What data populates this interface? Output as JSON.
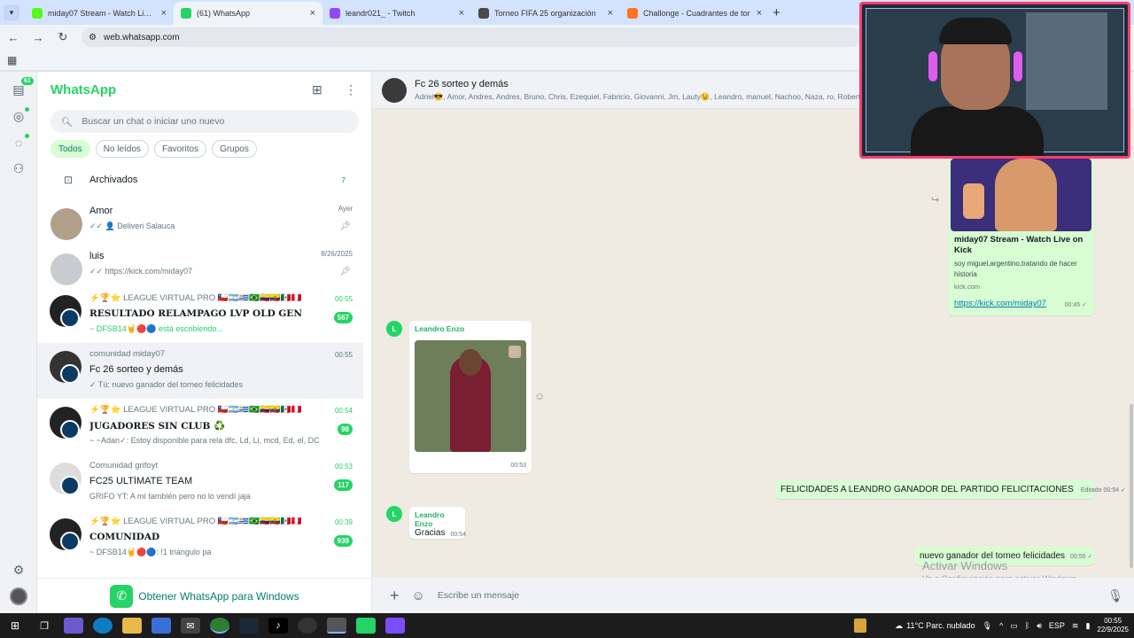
{
  "browser": {
    "tabs": [
      {
        "title": "miday07 Stream - Watch Live o",
        "favicon_color": "#53fc18",
        "active": false
      },
      {
        "title": "(61) WhatsApp",
        "favicon_color": "#25d366",
        "active": true
      },
      {
        "title": "leandr021_ - Twitch",
        "favicon_color": "#9146ff",
        "active": false
      },
      {
        "title": "Torneo FIFA 25 organización",
        "favicon_color": "#4a4a4a",
        "active": false
      },
      {
        "title": "Challonge - Cuadrantes de tor",
        "favicon_color": "#ff7324",
        "active": false
      }
    ],
    "url": "web.whatsapp.com"
  },
  "rail": {
    "chats_badge": "61"
  },
  "sidebar": {
    "brand": "WhatsApp",
    "search_placeholder": "Buscar un chat o iniciar uno nuevo",
    "filters": [
      "Todos",
      "No leídos",
      "Favoritos",
      "Grupos"
    ],
    "archived_label": "Archivados",
    "archived_count": "7",
    "get_app_label": "Obtener WhatsApp para Windows"
  },
  "chats": [
    {
      "line1": "",
      "name": "Amor",
      "preview": "✓✓ 👤 Deliveri Salauca",
      "time": "Ayer",
      "unread": "",
      "pinned": true,
      "avatar_color": "#b3a08a"
    },
    {
      "line1": "",
      "name": "luis",
      "preview": "✓✓ https://kick.com/miday07",
      "time": "8/26/2025",
      "unread": "",
      "pinned": true,
      "avatar_color": "#c8ccd0"
    },
    {
      "line1": "⚡🏆⭐ LEAGUE VIRTUAL PRO 🇨🇱🇦🇷🇺🇾🇧🇷🇨🇴🇪🇨🇲🇽🇵🇪",
      "name": "RESULTADO RELAMPAGO LVP OLD GEN",
      "preview": "~ DFSB14🤘🔴🔵 está escribiendo...",
      "time": "00:55",
      "unread": "567",
      "typing": true,
      "avatar_color": "#222"
    },
    {
      "line1": "comunidad miday07",
      "name": "Fc 26 sorteo y demás",
      "preview": "✓ Tú: nuevo ganador del torneo felicidades",
      "time": "00:55",
      "unread": "",
      "selected": true,
      "avatar_color": "#333"
    },
    {
      "line1": "⚡🏆⭐ LEAGUE VIRTUAL PRO 🇨🇱🇦🇷🇺🇾🇧🇷🇨🇴🇪🇨🇲🇽🇵🇪",
      "name": "JUGADORES SIN CLUB ♻️",
      "preview": "~ ~Adan✓: Estoy disponible para rela dfc, Ld, Li, mcd, Ed, el, DC",
      "time": "00:54",
      "unread": "98",
      "avatar_color": "#222"
    },
    {
      "line1": "Comunidad grifoyt",
      "name": "FC25 ULTÍMATE TEAM",
      "preview": "GRIFO YT: A mí también pero no lo vendí jaja",
      "time": "00:53",
      "unread": "117",
      "avatar_color": "#ddd"
    },
    {
      "line1": "⚡🏆⭐ LEAGUE VIRTUAL PRO 🇨🇱🇦🇷🇺🇾🇧🇷🇨🇴🇪🇨🇲🇽🇵🇪",
      "name": "COMUNIDAD",
      "preview": "~ DFSB14🤘🔴🔵: !1 triángulo pa",
      "time": "00:39",
      "unread": "939",
      "avatar_color": "#222"
    }
  ],
  "conversation": {
    "name": "Fc 26 sorteo y demás",
    "members": "Adriel😎, Amor, Andres, Andres, Bruno, Chris, Ezequiel, Fabricio, Giovanni, Jm, Lauty😉, Leandro, manuel, Nachoo, Naza, ro, Roberto",
    "link_card": {
      "title": "miday07 Stream - Watch Live on Kick",
      "description": "soy miguel,argentino,tratando de hacer historia",
      "domain": "kick.com",
      "url": "https://kick.com/miday07",
      "time": "00:45"
    },
    "gif_message": {
      "sender": "Leandro Enzo",
      "avatar_letter": "L",
      "time": "00:53"
    },
    "out_message_1": {
      "text": "FELICIDADES A LEANDRO GANADOR DEL PARTIDO FELICITACIONES",
      "edited": "Editado",
      "time": "00:54"
    },
    "in_message": {
      "sender": "Leandro Enzo",
      "avatar_letter": "L",
      "text": "Gracias",
      "time": "00:54"
    },
    "out_message_2": {
      "text": "nuevo ganador del torneo felicidades",
      "time": "00:55"
    },
    "compose_placeholder": "Escribe un mensaje",
    "watermark_title": "Activar Windows",
    "watermark_sub": "Ve a Configuración para activar Windows."
  },
  "taskbar": {
    "weather": "11°C  Parc. nublado",
    "lang": "ESP",
    "time": "00:55",
    "date": "22/9/2025"
  }
}
